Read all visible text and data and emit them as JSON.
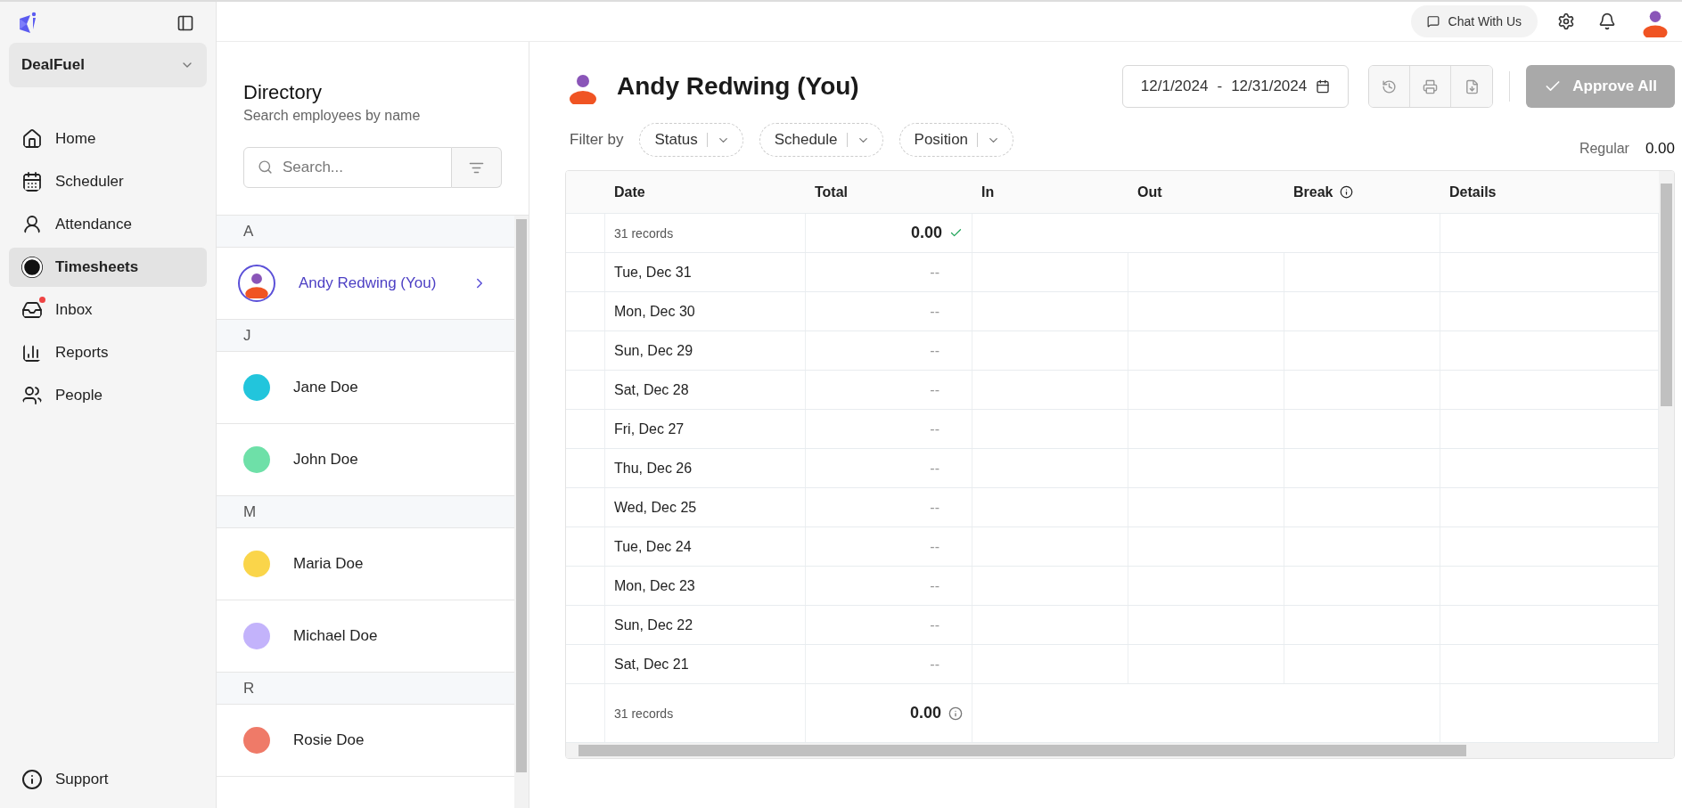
{
  "sidebar": {
    "workspace": "DealFuel",
    "nav": [
      {
        "label": "Home",
        "selected": false,
        "dot": false
      },
      {
        "label": "Scheduler",
        "selected": false,
        "dot": false
      },
      {
        "label": "Attendance",
        "selected": false,
        "dot": false
      },
      {
        "label": "Timesheets",
        "selected": true,
        "dot": false
      },
      {
        "label": "Inbox",
        "selected": false,
        "dot": true
      },
      {
        "label": "Reports",
        "selected": false,
        "dot": false
      },
      {
        "label": "People",
        "selected": false,
        "dot": false
      }
    ],
    "support": "Support"
  },
  "topbar": {
    "chat": "Chat With Us"
  },
  "directory": {
    "title": "Directory",
    "subtitle": "Search employees by name",
    "search": {
      "placeholder": "Search..."
    },
    "groups": [
      {
        "letter": "A",
        "people": [
          {
            "name": "Andy Redwing (You)",
            "selected": true,
            "color": "#ffffff"
          }
        ]
      },
      {
        "letter": "J",
        "people": [
          {
            "name": "Jane Doe",
            "selected": false,
            "color": "#22c5dc"
          },
          {
            "name": "John Doe",
            "selected": false,
            "color": "#6ee0a8"
          }
        ]
      },
      {
        "letter": "M",
        "people": [
          {
            "name": "Maria Doe",
            "selected": false,
            "color": "#fad54a"
          },
          {
            "name": "Michael Doe",
            "selected": false,
            "color": "#c3b3fb"
          }
        ]
      },
      {
        "letter": "R",
        "people": [
          {
            "name": "Rosie Doe",
            "selected": false,
            "color": "#ef7a68"
          }
        ]
      }
    ]
  },
  "timesheet": {
    "employee": "Andy Redwing (You)",
    "date_from": "12/1/2024",
    "date_separator": "-",
    "date_to": "12/31/2024",
    "approve": {
      "label": "Approve All",
      "disabled": true
    },
    "filter_label": "Filter by",
    "filters": [
      "Status",
      "Schedule",
      "Position"
    ],
    "summary_label": "Regular",
    "summary_value": "0.00",
    "table": {
      "columns": [
        "Date",
        "Total",
        "In",
        "Out",
        "Break",
        "Details"
      ],
      "summary": {
        "records": "31 records",
        "total": "0.00"
      },
      "rows": [
        {
          "date": "Tue, Dec 31",
          "total": "--"
        },
        {
          "date": "Mon, Dec 30",
          "total": "--"
        },
        {
          "date": "Sun, Dec 29",
          "total": "--"
        },
        {
          "date": "Sat, Dec 28",
          "total": "--"
        },
        {
          "date": "Fri, Dec 27",
          "total": "--"
        },
        {
          "date": "Thu, Dec 26",
          "total": "--"
        },
        {
          "date": "Wed, Dec 25",
          "total": "--"
        },
        {
          "date": "Tue, Dec 24",
          "total": "--"
        },
        {
          "date": "Mon, Dec 23",
          "total": "--"
        },
        {
          "date": "Sun, Dec 22",
          "total": "--"
        },
        {
          "date": "Sat, Dec 21",
          "total": "--"
        }
      ],
      "footer": {
        "records": "31 records",
        "total": "0.00"
      }
    }
  }
}
